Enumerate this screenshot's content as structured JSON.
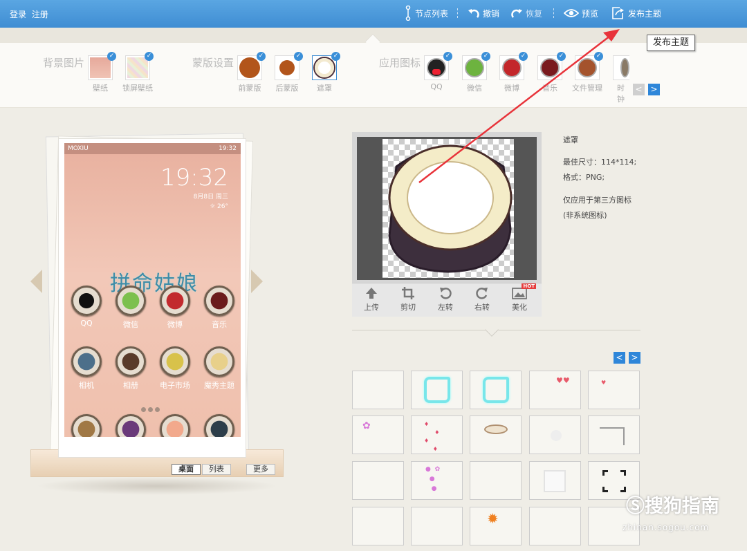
{
  "topbar": {
    "login": "登录",
    "register": "注册",
    "nodes": "节点列表",
    "undo": "撤销",
    "redo": "恢复",
    "preview": "预览",
    "publish": "发布主题"
  },
  "tooltip": "发布主题",
  "panel": {
    "bg_label": "背景图片",
    "bg_items": [
      "壁纸",
      "锁屏壁纸"
    ],
    "mask_label": "蒙版设置",
    "mask_items": [
      "前蒙版",
      "后蒙版",
      "遮罩"
    ],
    "icon_label": "应用图标",
    "icon_items": [
      "QQ",
      "微信",
      "微博",
      "音乐",
      "文件管理",
      "时钟"
    ]
  },
  "phone": {
    "carrier": "MOXIU",
    "status_time": "19:32",
    "clock": "19:32",
    "date": "8月8日 周三",
    "weather": "☼ 26°",
    "overlay": "拼命姑娘",
    "apps_row1": [
      "QQ",
      "微信",
      "微博",
      "音乐"
    ],
    "apps_row2": [
      "相机",
      "相册",
      "电子市场",
      "魔秀主题"
    ],
    "tabs": [
      "桌面",
      "列表",
      "更多"
    ]
  },
  "editor": {
    "tools": [
      "上传",
      "剪切",
      "左转",
      "右转",
      "美化"
    ],
    "hot": "HOT"
  },
  "info": {
    "title": "遮罩",
    "size": "最佳尺寸：114*114;",
    "format": "格式：PNG;",
    "note1": "仅应用于第三方图标",
    "note2": "(非系统图标)"
  },
  "watermark": {
    "main": "搜狗指南",
    "sub": "zhinan.sogou.com"
  },
  "colors": {
    "topbar": "#4a9be0",
    "accent": "#3a8fd8",
    "arrow": "#e8333a"
  }
}
